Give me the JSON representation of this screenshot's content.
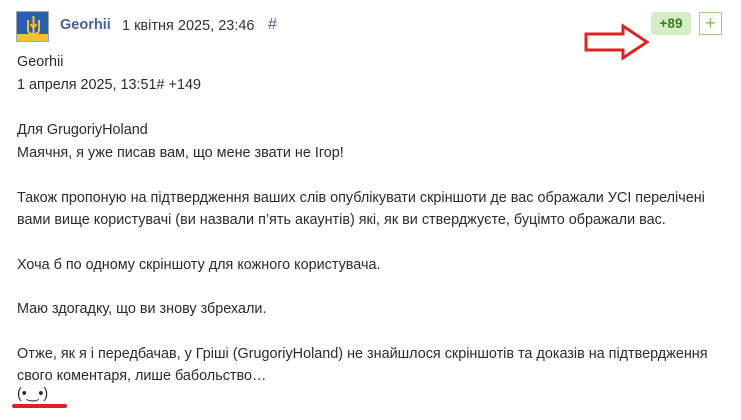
{
  "comment": {
    "author": "Georhii",
    "date": "1 квітня 2025, 23:46",
    "permalink": "#",
    "score": "+89",
    "plus_label": "+",
    "avatar_icon": "ukraine-trident-flag-icon",
    "quote_author": "Georhii",
    "quote_meta": "1 апреля 2025, 13:51# +149",
    "lines": [
      "Для GrugoriyHoland",
      "Маячня, я уже писав вам, що мене звати не Ігор!",
      "Також пропоную на підтвердження ваших слів опублікувати скріншоти де вас ображали УСІ перелічені",
      "вами вище користувачі (ви назвали п’ять акаунтів) які, як ви стверджуєте, буцімто ображали вас.",
      "Хоча б по одному скріншоту для кожного користувача.",
      "Маю здогадку, що ви знову збрехали.",
      "Отже, як я і передбачав, у Гріші (GrugoriyHoland) не знайшлося скріншотів та доказів на підтвердження",
      "свого коментаря, лише бабольство…",
      "(•‿•)"
    ]
  },
  "colors": {
    "accent": "#4a5f9e",
    "score_bg": "#d6ecc6",
    "score_text": "#3b7a22",
    "annotation": "#dd2222"
  }
}
